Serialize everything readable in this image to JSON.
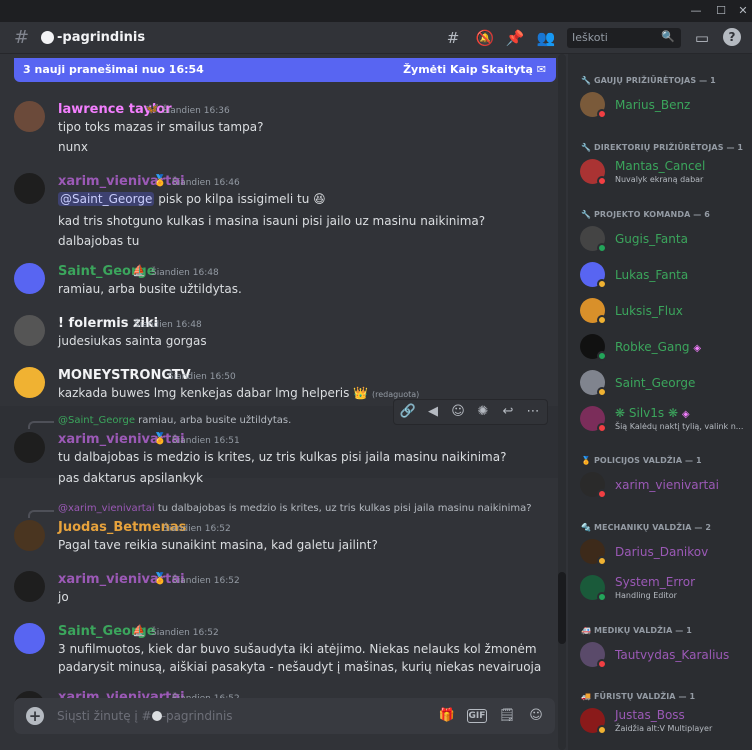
{
  "window": {
    "minimize": "—",
    "maximize": "☐",
    "close": "✕"
  },
  "header": {
    "hash": "#",
    "channel": "-pagrindinis",
    "search_placeholder": "Ieškoti"
  },
  "banner": {
    "text": "3 nauji pranešimai nuo 16:54",
    "action": "Žymėti Kaip Skaitytą"
  },
  "messages": [
    {
      "user": "lawrence taylor",
      "color": "#f47fff",
      "time": "Šiandien 16:36",
      "lines": [
        "tipo toks mazas ir smailus tampa?",
        "nunx"
      ]
    },
    {
      "user": "xarim_vienivartai",
      "color": "#9b59b6",
      "time": "Šiandien 16:46",
      "mention": "@Saint_George",
      "line1_rest": " pisk po kilpa issigimeli tu",
      "lines": [
        "kad tris shotguno kulkas i masina isauni pisi jailo uz masinu naikinima?",
        "dalbajobas tu"
      ]
    },
    {
      "user": "Saint_George",
      "color": "#3ba55c",
      "time": "Šiandien 16:48",
      "lines": [
        "ramiau, arba busite užtildytas."
      ]
    },
    {
      "user": "! folermis ziki",
      "color": "#f2f3f5",
      "time": "Šiandien 16:48",
      "lines": [
        "judesiukas sainta gorgas"
      ]
    },
    {
      "user": "MONEYSTRONGTV",
      "color": "#f2f3f5",
      "time": "Šiandien 16:50",
      "lines": [
        "kazkada buwes lmg kenkejas dabar lmg helperis"
      ],
      "edited": "(redaguota)"
    },
    {
      "reply_user": "@Saint_George",
      "reply_text": "ramiau, arba busite užtildytas.",
      "user": "xarim_vienivartai",
      "color": "#9b59b6",
      "time": "Šiandien 16:51",
      "lines": [
        "tu dalbajobas is medzio is krites, uz tris kulkas pisi jaila masinu naikinima?",
        "pas daktarus apsilankyk"
      ]
    },
    {
      "reply_user": "@xarim_vienivartai",
      "reply_text": "tu dalbajobas is medzio is krites, uz tris kulkas pisi jaila masinu naikinima?",
      "user": "Juodas_Betmenas",
      "color": "#e6a23c",
      "time": "Šiandien 16:52",
      "lines": [
        "Pagal tave reikia sunaikint masina, kad galetu jailint?"
      ]
    },
    {
      "user": "xarim_vienivartai",
      "color": "#9b59b6",
      "time": "Šiandien 16:52",
      "lines": [
        "jo"
      ]
    },
    {
      "user": "Saint_George",
      "color": "#3ba55c",
      "time": "Šiandien 16:52",
      "lines": [
        "3 nufilmuotos, kiek dar buvo sušaudyta iki atėjimo. Niekas nelauks kol žmonėm",
        "padarysit minusą, aiškiai pasakyta - nešaudyt į mašinas, kurių niekas nevairuoja"
      ]
    },
    {
      "user": "xarim_vienivartai",
      "color": "#9b59b6",
      "time": "Šiandien 16:52",
      "lines": []
    }
  ],
  "input": {
    "placeholder": "Siųsti žinutę į #",
    "channel": "-pagrindinis"
  },
  "members": {
    "roles": [
      {
        "title": "GAUJŲ PRIŽIŪRĖTOJAS — 1"
      },
      {
        "title": "DIREKTORIŲ PRIŽIŪRĖTOJAS — 1"
      },
      {
        "title": "PROJEKTO KOMANDA — 6"
      },
      {
        "title": "POLICIJOS VALDŽIA — 1"
      },
      {
        "title": "MECHANIKŲ VALDŽIA — 2"
      },
      {
        "title": "MEDIKŲ VALDŽIA — 1"
      },
      {
        "title": "FŪRISTŲ VALDŽIA — 1"
      }
    ],
    "list": [
      {
        "name": "Marius_Benz",
        "color": "#3ba55c",
        "sub": ""
      },
      {
        "name": "Mantas_Cancel",
        "color": "#3ba55c",
        "sub": "Nuvalyk ekraną dabar"
      },
      {
        "name": "Gugis_Fanta",
        "color": "#3ba55c",
        "sub": ""
      },
      {
        "name": "Lukas_Fanta",
        "color": "#3ba55c",
        "sub": ""
      },
      {
        "name": "Luksis_Flux",
        "color": "#3ba55c",
        "sub": ""
      },
      {
        "name": "Robke_Gang",
        "color": "#3ba55c",
        "sub": ""
      },
      {
        "name": "Saint_George",
        "color": "#3ba55c",
        "sub": ""
      },
      {
        "name": "❋ Silv1s ❋",
        "color": "#3ba55c",
        "sub": "Šią Kalėdų naktį tylią, valink n..."
      },
      {
        "name": "xarim_vienivartai",
        "color": "#9b59b6",
        "sub": ""
      },
      {
        "name": "Darius_Danikov",
        "color": "#9b59b6",
        "sub": ""
      },
      {
        "name": "System_Error",
        "color": "#9b59b6",
        "sub": "Handling Editor"
      },
      {
        "name": "Tautvydas_Karalius",
        "color": "#9b59b6",
        "sub": ""
      },
      {
        "name": "Justas_Boss",
        "color": "#9b59b6",
        "sub": "Žaidžia alt:V Multiplayer"
      }
    ]
  }
}
